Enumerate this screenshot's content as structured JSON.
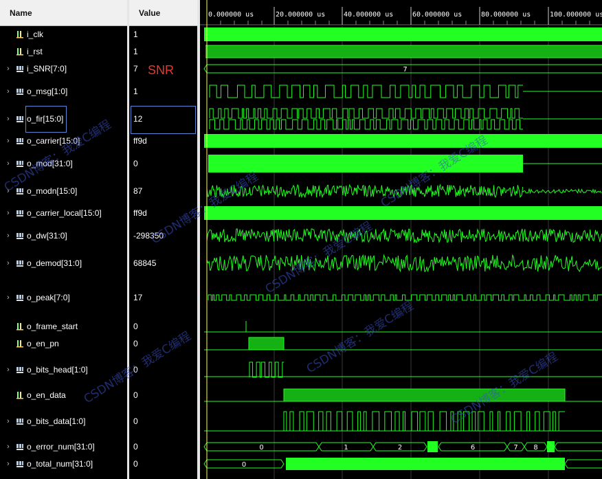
{
  "columns": {
    "name": "Name",
    "value": "Value"
  },
  "annotation": "SNR",
  "timeline": {
    "ticks": [
      "0.000000 us",
      "20.000000 us",
      "40.000000 us",
      "60.000000 us",
      "80.000000 us",
      "100.000000 us"
    ]
  },
  "signals": [
    {
      "name": "i_clk",
      "value": "1",
      "kind": "bit"
    },
    {
      "name": "i_rst",
      "value": "1",
      "kind": "bit"
    },
    {
      "name": "i_SNR[7:0]",
      "value": "7",
      "kind": "bus"
    },
    {
      "name": "o_msg[1:0]",
      "value": "1",
      "kind": "bus"
    },
    {
      "name": "o_fir[15:0]",
      "value": "12",
      "kind": "bus"
    },
    {
      "name": "o_carrier[15:0]",
      "value": "ff9d",
      "kind": "bus"
    },
    {
      "name": "o_mod[31:0]",
      "value": "0",
      "kind": "bus"
    },
    {
      "name": "o_modn[15:0]",
      "value": "87",
      "kind": "bus"
    },
    {
      "name": "o_carrier_local[15:0]",
      "value": "ff9d",
      "kind": "bus"
    },
    {
      "name": "o_dw[31:0]",
      "value": "-298350",
      "kind": "bus"
    },
    {
      "name": "o_demod[31:0]",
      "value": "68845",
      "kind": "bus"
    },
    {
      "name": "o_peak[7:0]",
      "value": "17",
      "kind": "bus"
    },
    {
      "name": "o_frame_start",
      "value": "0",
      "kind": "bit"
    },
    {
      "name": "o_en_pn",
      "value": "0",
      "kind": "bit"
    },
    {
      "name": "o_bits_head[1:0]",
      "value": "0",
      "kind": "bus"
    },
    {
      "name": "o_en_data",
      "value": "0",
      "kind": "bit"
    },
    {
      "name": "o_bits_data[1:0]",
      "value": "0",
      "kind": "bus"
    },
    {
      "name": "o_error_num[31:0]",
      "value": "0",
      "kind": "bus"
    },
    {
      "name": "o_total_num[31:0]",
      "value": "0",
      "kind": "bus"
    }
  ],
  "bus_labels": {
    "snr": "7",
    "error_num": [
      "0",
      "1",
      "2",
      "6",
      "7",
      "8"
    ],
    "total_num": [
      "0"
    ]
  },
  "watermark": "CSDN博客：我爱C编程"
}
